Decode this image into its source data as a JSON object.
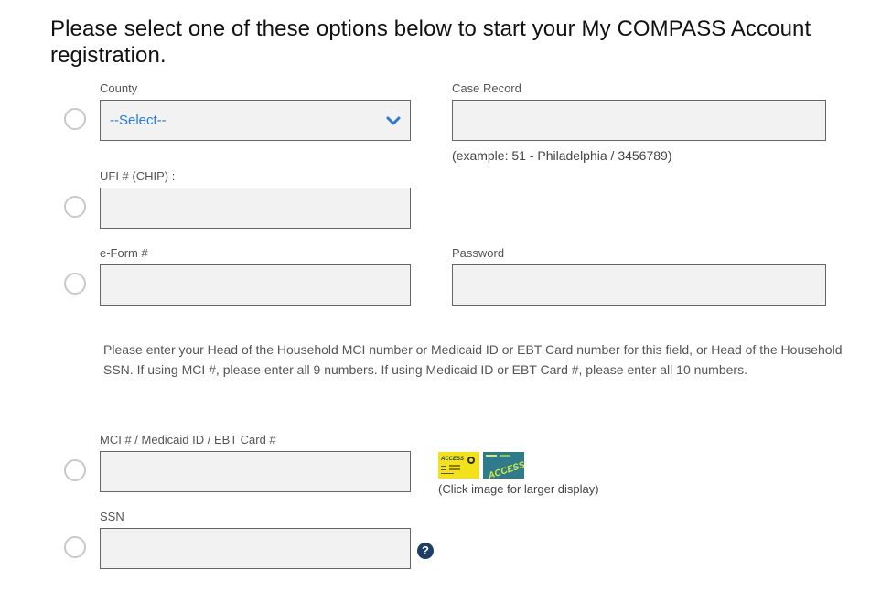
{
  "heading": "Please select one of these options below to start your My COMPASS Account registration.",
  "options": {
    "county_case": {
      "county_label": "County",
      "county_selected": "--Select--",
      "case_label": "Case Record",
      "case_value": "",
      "case_hint": "(example: 51 - Philadelphia / 3456789)"
    },
    "ufi": {
      "label": "UFI # (CHIP) :",
      "value": ""
    },
    "eform": {
      "eform_label": "e-Form #",
      "eform_value": "",
      "password_label": "Password",
      "password_value": ""
    },
    "instructions": "Please enter your Head of the Household MCI number or Medicaid ID or EBT Card number for this field, or Head of the Household SSN. If using MCI #, please enter all 9 numbers. If using Medicaid ID or EBT Card #, please enter all 10 numbers.",
    "mci": {
      "label": "MCI # / Medicaid ID / EBT Card #",
      "value": "",
      "card_images": [
        {
          "name": "access-card-yellow",
          "text": "ACCESS"
        },
        {
          "name": "access-card-teal",
          "text": "ACCESS"
        }
      ],
      "click_note": "(Click image for larger display)"
    },
    "ssn": {
      "label": "SSN",
      "value": "",
      "help_icon": "?"
    }
  },
  "colors": {
    "select_text": "#2a7bd1",
    "help_icon_bg": "#1d3f66",
    "field_bg": "#f2f2f2",
    "field_border": "#666666"
  }
}
